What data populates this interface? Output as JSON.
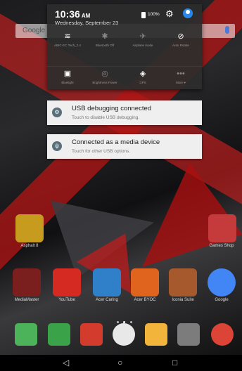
{
  "search": {
    "label": "Google"
  },
  "shade": {
    "time": "10:36",
    "ampm": "AM",
    "date": "Wednesday, September 23",
    "battery": "100%",
    "tiles": [
      {
        "icon": "wifi-icon",
        "glyph": "≋",
        "label": "ABIC-EC Tech_2.4",
        "active": true
      },
      {
        "icon": "bluetooth-icon",
        "glyph": "✱",
        "label": "Bluetooth Off",
        "active": false
      },
      {
        "icon": "airplane-icon",
        "glyph": "✈",
        "label": "Airplane mode",
        "active": false
      },
      {
        "icon": "auto-rotate-icon",
        "glyph": "⊘",
        "label": "Auto Rotate",
        "active": true
      },
      {
        "icon": "bluelight-icon",
        "glyph": "▣",
        "label": "Bluelight",
        "active": true
      },
      {
        "icon": "brightness-icon",
        "glyph": "◎",
        "label": "Brightness Power",
        "active": false
      },
      {
        "icon": "location-icon",
        "glyph": "◈",
        "label": "GPS",
        "active": true
      },
      {
        "icon": "more-icon",
        "glyph": "•••",
        "label": "More ▾",
        "active": false
      }
    ]
  },
  "notifications": [
    {
      "icon": "usb-debug-icon",
      "glyph": "⚙",
      "title": "USB debugging connected",
      "text": "Touch to disable USB debugging."
    },
    {
      "icon": "usb-icon",
      "glyph": "ψ",
      "title": "Connected as a media device",
      "text": "Touch for other USB options."
    }
  ],
  "home": {
    "row1": [
      {
        "name": "asphalt-8",
        "label": "Asphalt 8",
        "color": "#c79b1e"
      },
      {
        "name": "games-shop",
        "label": "Games Shop",
        "color": "#c53b3b"
      }
    ],
    "row2": [
      {
        "name": "mediamaster",
        "label": "MediaMaster",
        "color": "#7a1e1e"
      },
      {
        "name": "youtube",
        "label": "YouTube",
        "color": "#d42a22"
      },
      {
        "name": "acer-caring",
        "label": "Acer Caring",
        "color": "#2f7fc9"
      },
      {
        "name": "acer-byoc",
        "label": "Acer BYOC",
        "color": "#e0641d"
      },
      {
        "name": "iconia-suite",
        "label": "Iconia Suite",
        "color": "#a7592e"
      },
      {
        "name": "google",
        "label": "Google",
        "color": "#4285f4"
      }
    ],
    "dock": [
      {
        "name": "play-store",
        "color": "#4db35a"
      },
      {
        "name": "play-games",
        "color": "#3aa34a"
      },
      {
        "name": "gmail",
        "color": "#d33b2c"
      },
      {
        "name": "app-drawer",
        "color": "#e8e8e8"
      },
      {
        "name": "photos",
        "color": "#f2b43a"
      },
      {
        "name": "camera",
        "color": "#7c7c7c"
      },
      {
        "name": "chrome",
        "color": "#db4437"
      }
    ]
  },
  "nav": {
    "back": "◁",
    "home": "○",
    "recents": "□"
  }
}
